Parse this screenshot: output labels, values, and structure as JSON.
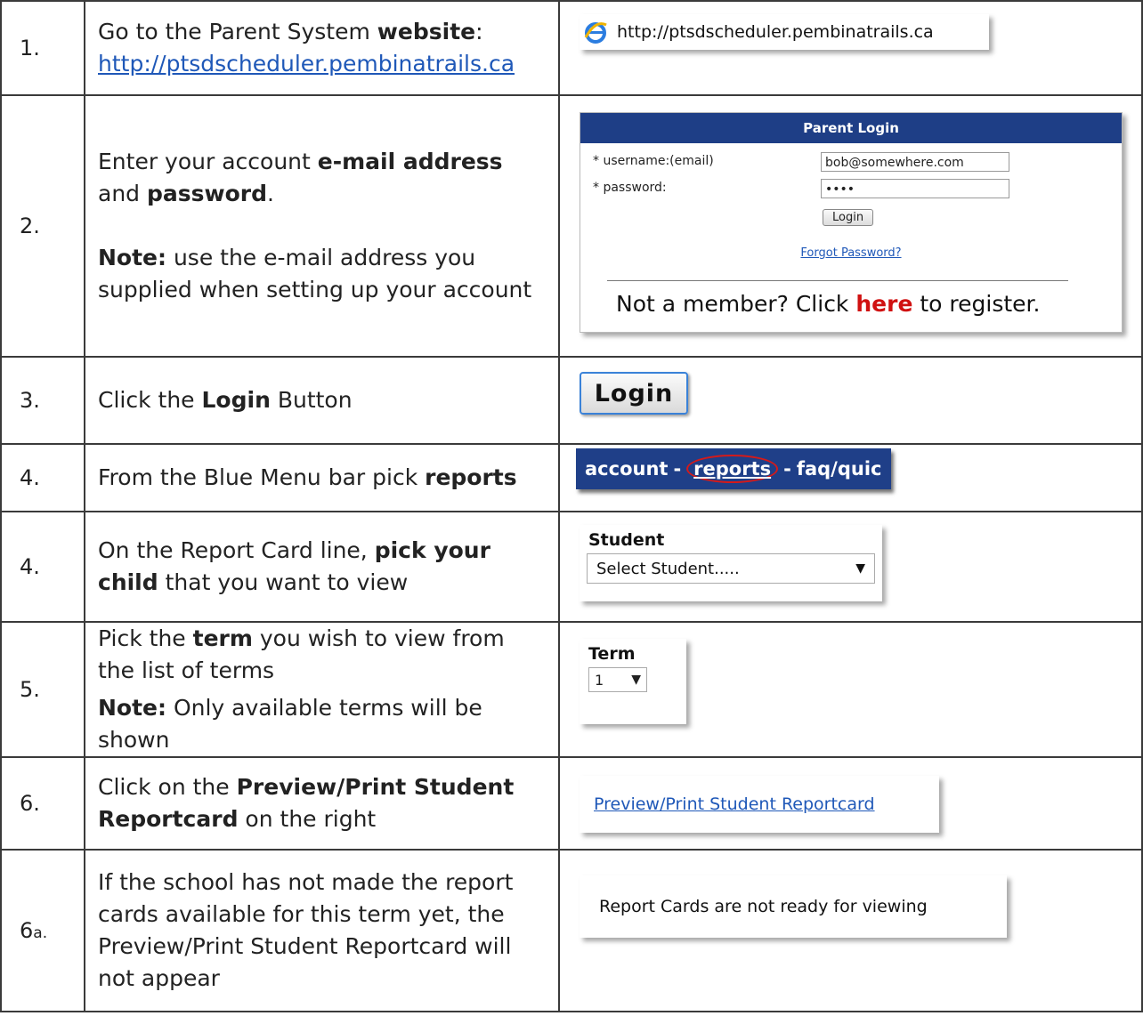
{
  "steps": [
    {
      "num": "1.",
      "text_before": "Go to the Parent System ",
      "bold": "website",
      "text_after": ":",
      "link": "http://ptsdscheduler.pembinatrails.ca",
      "screenshot": {
        "icon": "ie-icon",
        "url": "http://ptsdscheduler.pembinatrails.ca"
      }
    },
    {
      "num": "2.",
      "text_before": "Enter your account ",
      "bold1": "e-mail address",
      "text_mid": " and ",
      "bold2": "password",
      "text_after": ".",
      "note_label": "Note:",
      "note_text": " use the e-mail address you supplied when setting up your account",
      "screenshot": {
        "header": "Parent Login",
        "username_label": "* username:(email)",
        "username_value": "bob@somewhere.com",
        "password_label": "* password:",
        "password_value": "••••",
        "login_button": "Login",
        "forgot_link": "Forgot Password?",
        "member_before": "Not a member? Click ",
        "member_link": "here",
        "member_after": " to register."
      }
    },
    {
      "num": "3.",
      "text_before": "Click the ",
      "bold": "Login",
      "text_after": " Button",
      "screenshot": {
        "button": "Login"
      }
    },
    {
      "num": "4.",
      "text_before": "From the Blue Menu bar pick ",
      "bold": "reports",
      "screenshot": {
        "item1": "account",
        "sep1": "-",
        "item2": "reports",
        "sep2": "-",
        "item3": "faq/quic"
      }
    },
    {
      "num": "4.",
      "text_before": "On the Report Card line, ",
      "bold": "pick your child",
      "text_after": " that you want to view",
      "screenshot": {
        "label": "Student",
        "value": "Select Student....."
      }
    },
    {
      "num": "5.",
      "text_before": "Pick the ",
      "bold": "term",
      "text_after": " you wish to view from the list of terms",
      "note_label": "Note:",
      "note_text": " Only available terms will be shown",
      "screenshot": {
        "label": "Term",
        "value": "1"
      }
    },
    {
      "num": "6.",
      "text_before": "Click on the ",
      "bold": "Preview/Print Student Reportcard",
      "text_after": " on the right",
      "screenshot": {
        "link": "Preview/Print Student Reportcard"
      }
    },
    {
      "num": "6",
      "num_suffix": "a.",
      "text": "If the school has not made the report cards available for this term yet, the Preview/Print Student Reportcard will not appear",
      "screenshot": {
        "message": "Report Cards are not ready for viewing"
      }
    }
  ]
}
